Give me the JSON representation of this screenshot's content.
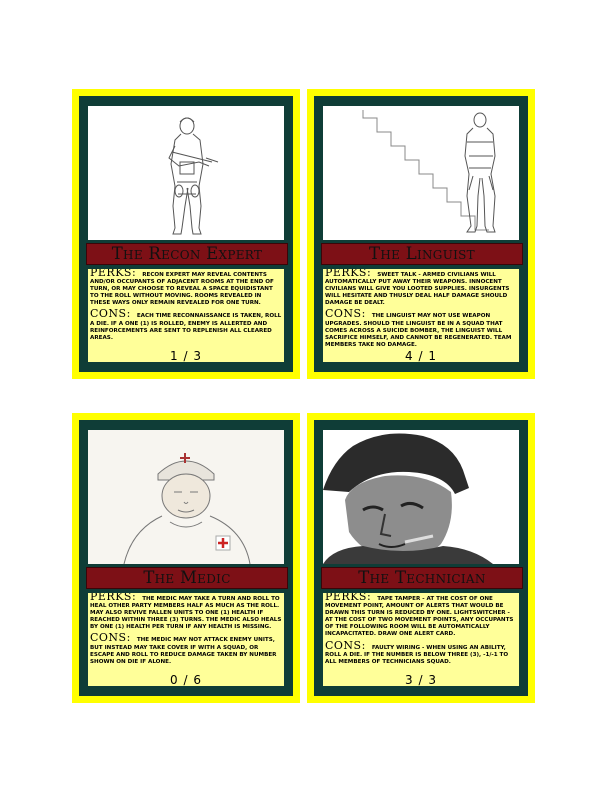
{
  "cards": [
    {
      "title": "The Recon Expert",
      "perks_label": "PERKS:",
      "perks_text": "Recon expert may reveal contents and/or occupants of adjacent rooms at the end of turn, or may choose to reveal a space equidistant to the roll without moving. Rooms revealed in these ways only remain revealed for one turn.",
      "cons_label": "CONS:",
      "cons_text": "Each time reconnaissance is taken, roll a die. If a one (1) is rolled, enemy is allerted and reinforcements are sent to replenish all cleared areas.",
      "count": "1 / 3",
      "art": "recon-soldier-sketch"
    },
    {
      "title": "The Linguist",
      "perks_label": "PERKS:",
      "perks_text": "Sweet talk - armed civilians will automatically put away their weapons. Innocent civilians will give you looted supplies. Insurgents will hesitate and thusly deal half damage should damage be dealt.",
      "cons_label": "CONS:",
      "cons_text": "The linguist may not use weapon upgrades. Should the linguist be in a squad that comes across a suicide bomber, the linguist will sacrifice himself, and cannot be regenerated. Team members take no damage.",
      "count": "4 / 1",
      "art": "linguist-soldier-sketch"
    },
    {
      "title": "The Medic",
      "perks_label": "PERKS:",
      "perks_text": "The medic may take a turn and roll to heal other party members half as much as the roll. May also revive fallen units to one (1) health if reached within three (3) turns. The medic also heals by one (1) health per turn if any health is missing.",
      "cons_label": "CONS:",
      "cons_text": "The medic may not attack enemy units, but instead may take cover if with a squad, or escape and roll to reduce damage taken by number shown on die if alone.",
      "count": "0 / 6",
      "art": "medic-portrait"
    },
    {
      "title": "The Technician",
      "perks_label": "PERKS:",
      "perks_text": "Tape tamper - at the cost of one movement point, amount of alerts that would be drawn this turn is reduced by one. Lightswitcher - at the cost of two movement points, any occupants of the following room will be automatically incapacitated. Draw one alert card.",
      "cons_label": "CONS:",
      "cons_text": "Faulty wiring - when using an ability, roll a die. If the number is below three (3), -1/-1 to all members of technicians squad.",
      "count": "3 / 3",
      "art": "technician-portrait"
    }
  ],
  "colors": {
    "card_border": "#ffff00",
    "frame": "#0f3d37",
    "title_bar": "#7d1016",
    "text_panel": "#ffff99"
  }
}
